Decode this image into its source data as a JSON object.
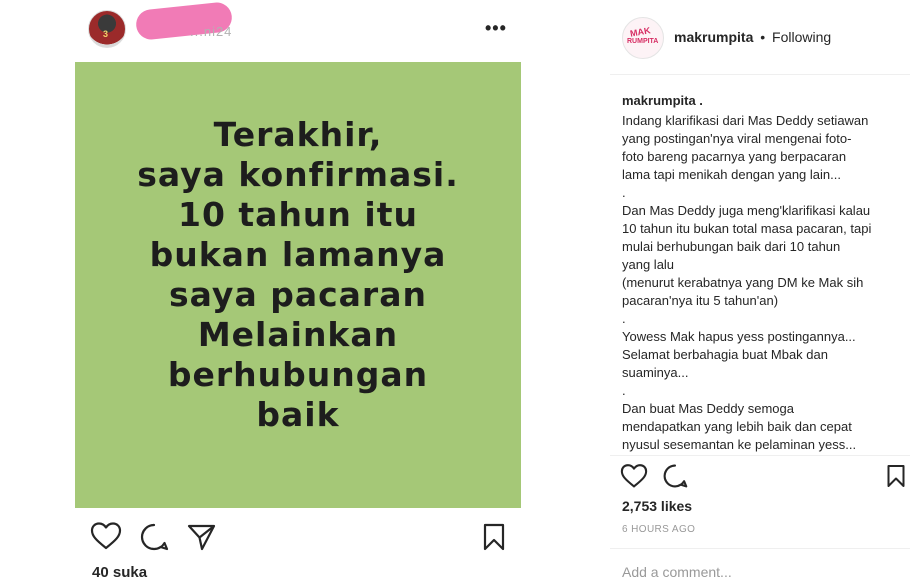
{
  "left_post": {
    "username_hidden": "...ni24",
    "more_label": "•••",
    "image_text": "Terakhir,\nsaya konfirmasi.\n10 tahun itu\nbukan lamanya\nsaya pacaran\nMelainkan\nberhubungan\nbaik",
    "image_bg_color": "#a5c877",
    "likes_text": "40 suka"
  },
  "right_panel": {
    "username": "makrumpita",
    "separator": "•",
    "follow_status": "Following",
    "avatar_logo_line1": "MAK",
    "avatar_logo_line2": "RUMPITA",
    "caption_username": "makrumpita .",
    "caption_lines": [
      "Indang klarifikasi dari Mas Deddy setiawan",
      "yang postingan'nya viral mengenai foto-",
      "foto bareng pacarnya yang berpacaran",
      "lama tapi menikah dengan yang lain...",
      ".",
      "Dan Mas Deddy juga meng'klarifikasi kalau",
      "10 tahun itu bukan total masa pacaran, tapi",
      "mulai berhubungan baik dari 10 tahun",
      "yang lalu",
      "(menurut kerabatnya yang DM ke Mak sih",
      "pacaran'nya itu 5 tahun'an)",
      ".",
      "Yowess Mak hapus yess postingannya...",
      "Selamat berbahagia buat Mbak dan",
      "suaminya...",
      ".",
      "Dan buat Mas Deddy semoga",
      "mendapatkan yang lebih baik dan cepat",
      "nyusul sesemantan ke pelaminan yess..."
    ],
    "likes_text": "2,753 likes",
    "time_text": "6 HOURS AGO",
    "comment_placeholder": "Add a comment..."
  }
}
